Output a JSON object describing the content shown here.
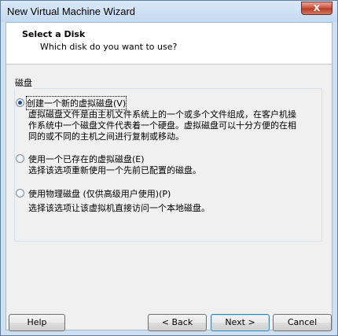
{
  "window": {
    "title": "New Virtual Machine Wizard",
    "close_glyph": "X"
  },
  "header": {
    "title": "Select a Disk",
    "subtitle": "Which disk do you want to use?"
  },
  "group": {
    "label": "磁盘"
  },
  "options": [
    {
      "label": "创建一个新的虚拟磁盘(V)",
      "checked": true,
      "desc_lines": [
        "虚拟磁盘文件是由主机文件系统上的一个或多个文件组成，在客户机操",
        "作系统中一个磁盘文件代表着一个硬盘。虚拟磁盘可以十分方便的在相",
        "同的或不同的主机之间进行复制或移动。"
      ]
    },
    {
      "label": "使用一个已存在的虚拟磁盘(E)",
      "checked": false,
      "desc_lines": [
        "选择该选项重新使用一个先前已配置的磁盘。"
      ]
    },
    {
      "label": "使用物理磁盘 (仅供高级用户使用)(P)",
      "checked": false,
      "desc_lines": [
        "选择该选项让该虚拟机直接访问一个本地磁盘。"
      ]
    }
  ],
  "buttons": {
    "help": "Help",
    "back": "< Back",
    "next": "Next >",
    "cancel": "Cancel"
  }
}
